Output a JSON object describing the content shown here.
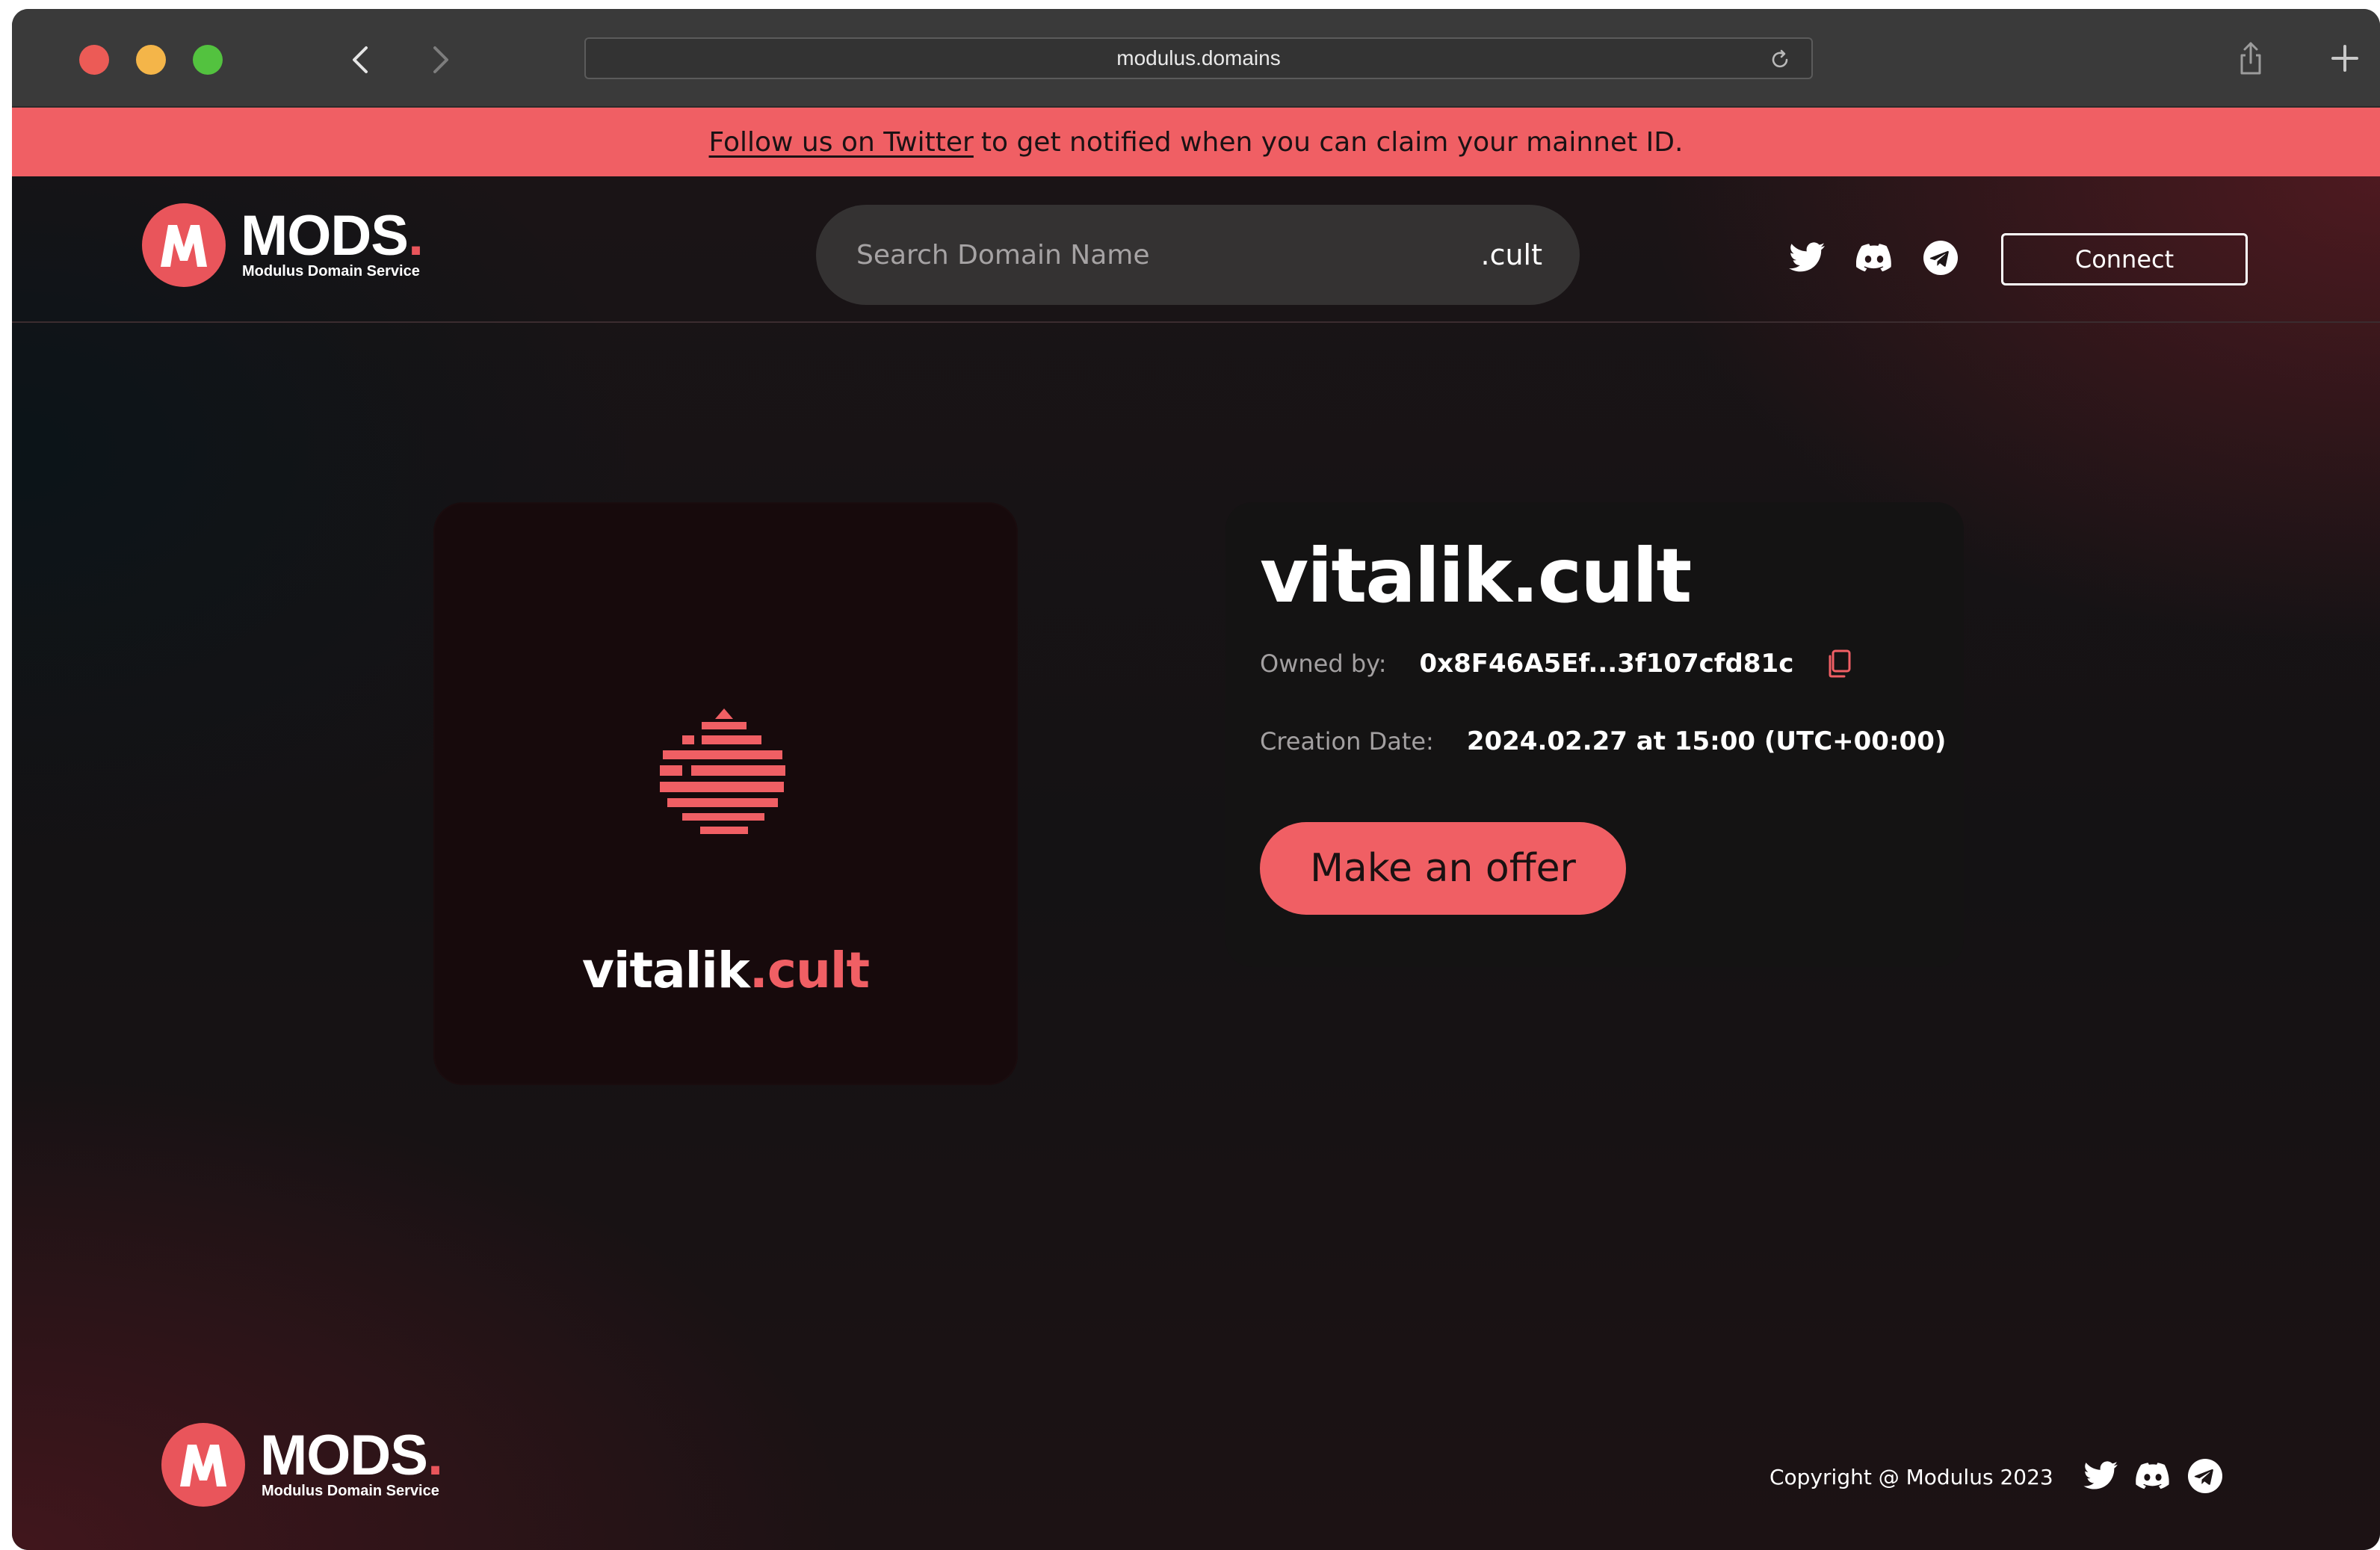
{
  "browser": {
    "url": "modulus.domains",
    "icons": {
      "back": "chevron-left-icon",
      "forward": "chevron-right-icon",
      "reload": "reload-icon",
      "share": "share-icon",
      "new_tab": "plus-icon"
    }
  },
  "banner": {
    "link_text": "Follow us on Twitter",
    "message": "to get notified when you can claim your mainnet ID."
  },
  "header": {
    "logo": {
      "wordmark": "MODS",
      "dot": ".",
      "subtitle": "Modulus Domain Service"
    },
    "search": {
      "placeholder": "Search Domain Name",
      "value": "",
      "suffix": ".cult"
    },
    "social": [
      "twitter-icon",
      "discord-icon",
      "telegram-icon"
    ],
    "connect_label": "Connect"
  },
  "domain": {
    "image_name": "vitalik",
    "image_tld": ".cult",
    "title": "vitalik.cult",
    "owned_by_label": "Owned by:",
    "owner": "0x8F46A5Ef...3f107cfd81c",
    "creation_label": "Creation Date:",
    "creation_date": "2024.02.27 at 15:00 (UTC+00:00)",
    "offer_label": "Make an offer"
  },
  "footer": {
    "logo": {
      "wordmark": "MODS",
      "dot": ".",
      "subtitle": "Modulus Domain Service"
    },
    "copyright": "Copyright @ Modulus 2023",
    "social": [
      "twitter-icon",
      "discord-icon",
      "telegram-icon"
    ]
  },
  "colors": {
    "accent": "#f05f64",
    "banner": "#f05f64",
    "background": "#151313",
    "card": "#141313"
  }
}
